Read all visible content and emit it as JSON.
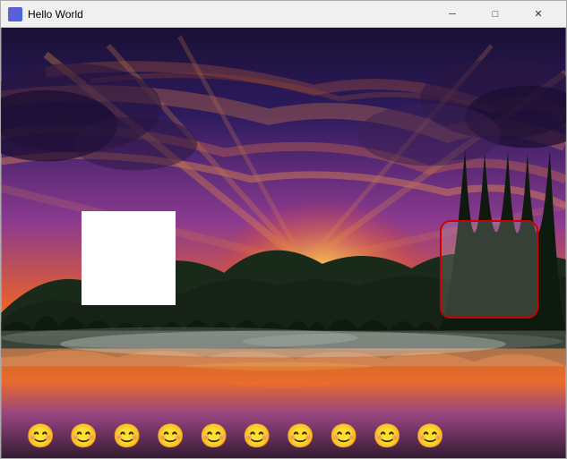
{
  "titlebar": {
    "title": "Hello World",
    "minimize_label": "─",
    "maximize_label": "□",
    "close_label": "✕"
  },
  "content": {
    "white_box": "white rectangle overlay",
    "red_box": "red rounded rectangle overlay"
  },
  "emoji_bar": {
    "emojis": [
      "😊",
      "😊",
      "😊",
      "😊",
      "😊",
      "😊",
      "😊",
      "😊",
      "😊",
      "😊"
    ]
  }
}
